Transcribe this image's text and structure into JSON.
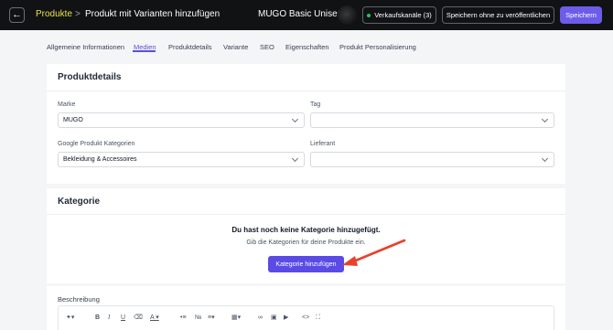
{
  "header": {
    "back_icon": "arrow-left-icon",
    "breadcrumb_root": "Produkte",
    "breadcrumb_separator": ">",
    "page_title": "Produkt mit Varianten hinzufügen",
    "product_name": "MUGO Basic Unise:",
    "sales_channels_label": "Verkaufskanäle (3)",
    "sales_channels_status_color": "#22c55e",
    "save_draft_label": "Speichern ohne zu veröffentlichen",
    "save_label": "Speichern",
    "accent_color": "#6d5ce8"
  },
  "tabs": [
    {
      "label": "Allgemeine Informationen"
    },
    {
      "label": "Medien"
    },
    {
      "label": "Produktdetails"
    },
    {
      "label": "Variante"
    },
    {
      "label": "SEO"
    },
    {
      "label": "Eigenschaften"
    },
    {
      "label": "Produkt Personalisierung"
    }
  ],
  "active_tab": "Medien",
  "details": {
    "title": "Produktdetails",
    "brand_label": "Marke",
    "brand_value": "MUGO",
    "tag_label": "Tag",
    "tag_value": "",
    "google_category_label": "Google Produkt Kategorien",
    "google_category_value": "Bekleidung & Accessoires",
    "supplier_label": "Lieferant",
    "supplier_value": ""
  },
  "category": {
    "title": "Kategorie",
    "empty_title": "Du hast noch keine Kategorie hinzugefügt.",
    "empty_subtitle": "Gib die Kategorien für deine Produkte ein.",
    "add_button_label": "Kategorie hinzufügen",
    "annotation_arrow_color": "#e8412c"
  },
  "description": {
    "title": "Beschreibung",
    "toolbar_icons": [
      "magic-wand-icon",
      "bold-icon",
      "italic-icon",
      "underline-icon",
      "eraser-icon",
      "text-color-icon",
      "bullet-list-icon",
      "numbered-list-icon",
      "align-icon",
      "table-icon",
      "link-icon",
      "image-icon",
      "video-icon",
      "code-icon",
      "fullscreen-icon"
    ]
  }
}
